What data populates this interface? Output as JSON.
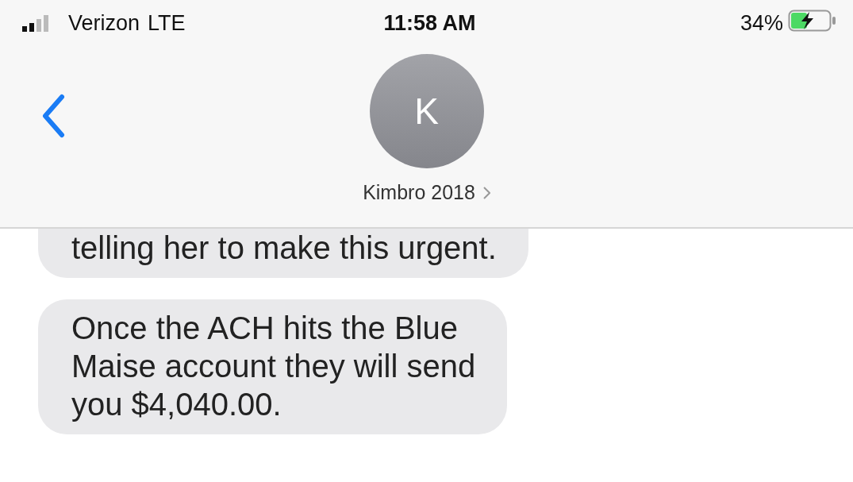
{
  "status_bar": {
    "carrier": "Verizon",
    "network": "LTE",
    "time": "11:58 AM",
    "battery_percent": "34%",
    "charging": true
  },
  "header": {
    "avatar_initial": "K",
    "contact_name": "Kimbro 2018"
  },
  "messages": [
    {
      "kind": "incoming",
      "text": "telling her to make this urgent."
    },
    {
      "kind": "incoming",
      "text": "Once the ACH hits the Blue\nMaise account they will send\nyou $4,040.00."
    }
  ]
}
